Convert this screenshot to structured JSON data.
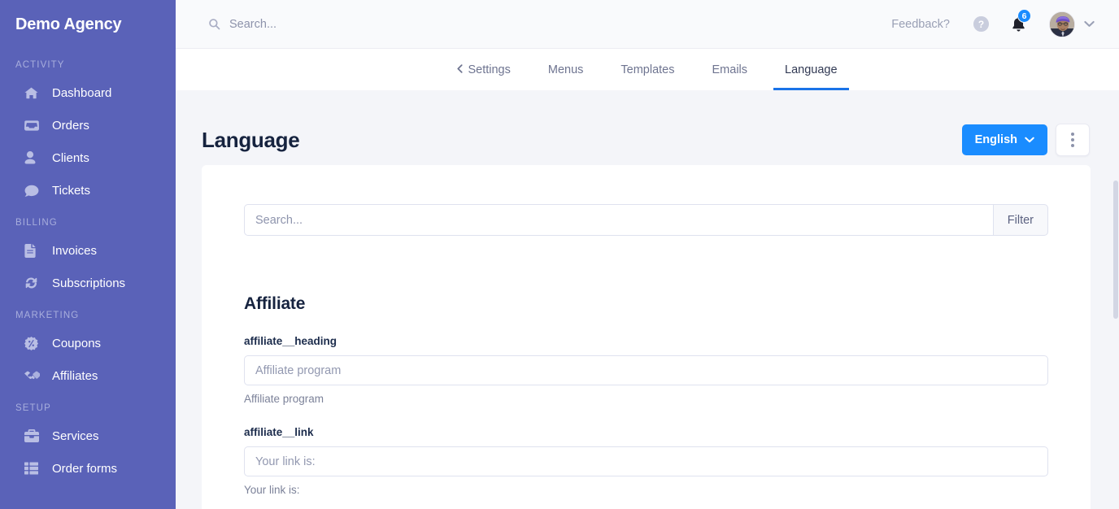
{
  "sidebar": {
    "brand": "Demo Agency",
    "sections": [
      {
        "label": "ACTIVITY",
        "items": [
          {
            "label": "Dashboard",
            "icon": "home-icon"
          },
          {
            "label": "Orders",
            "icon": "inbox-icon"
          },
          {
            "label": "Clients",
            "icon": "user-icon"
          },
          {
            "label": "Tickets",
            "icon": "comment-icon"
          }
        ]
      },
      {
        "label": "BILLING",
        "items": [
          {
            "label": "Invoices",
            "icon": "file-icon"
          },
          {
            "label": "Subscriptions",
            "icon": "sync-icon"
          }
        ]
      },
      {
        "label": "MARKETING",
        "items": [
          {
            "label": "Coupons",
            "icon": "badge-percent-icon"
          },
          {
            "label": "Affiliates",
            "icon": "handshake-icon"
          }
        ]
      },
      {
        "label": "SETUP",
        "items": [
          {
            "label": "Services",
            "icon": "toolbox-icon"
          },
          {
            "label": "Order forms",
            "icon": "table-icon"
          }
        ]
      }
    ]
  },
  "topbar": {
    "search_placeholder": "Search...",
    "search_value": "",
    "feedback_label": "Feedback?",
    "help_icon": "question-circle-icon",
    "bell_icon": "bell-icon",
    "notification_count": "6",
    "avatar_icon": "user-avatar",
    "caret_icon": "chevron-down-icon"
  },
  "tabs": [
    {
      "label": "Settings",
      "back": true,
      "active": false
    },
    {
      "label": "Menus",
      "back": false,
      "active": false
    },
    {
      "label": "Templates",
      "back": false,
      "active": false
    },
    {
      "label": "Emails",
      "back": false,
      "active": false
    },
    {
      "label": "Language",
      "back": false,
      "active": true
    }
  ],
  "page": {
    "title": "Language",
    "language_button": "English",
    "language_caret_icon": "chevron-down-icon",
    "more_menu_icon": "vertical-dots-icon"
  },
  "filter": {
    "placeholder": "Search...",
    "value": "",
    "button_label": "Filter"
  },
  "groups": [
    {
      "title": "Affiliate",
      "fields": [
        {
          "label": "affiliate__heading",
          "placeholder": "Affiliate program",
          "value": "",
          "help": "Affiliate program"
        },
        {
          "label": "affiliate__link",
          "placeholder": "Your link is:",
          "value": "",
          "help": "Your link is:"
        }
      ]
    }
  ],
  "colors": {
    "sidebar_bg": "#5a62b8",
    "primary": "#1a8cff",
    "tab_active": "#1a73e8",
    "page_bg": "#f4f5f9",
    "heading": "#16233f"
  }
}
